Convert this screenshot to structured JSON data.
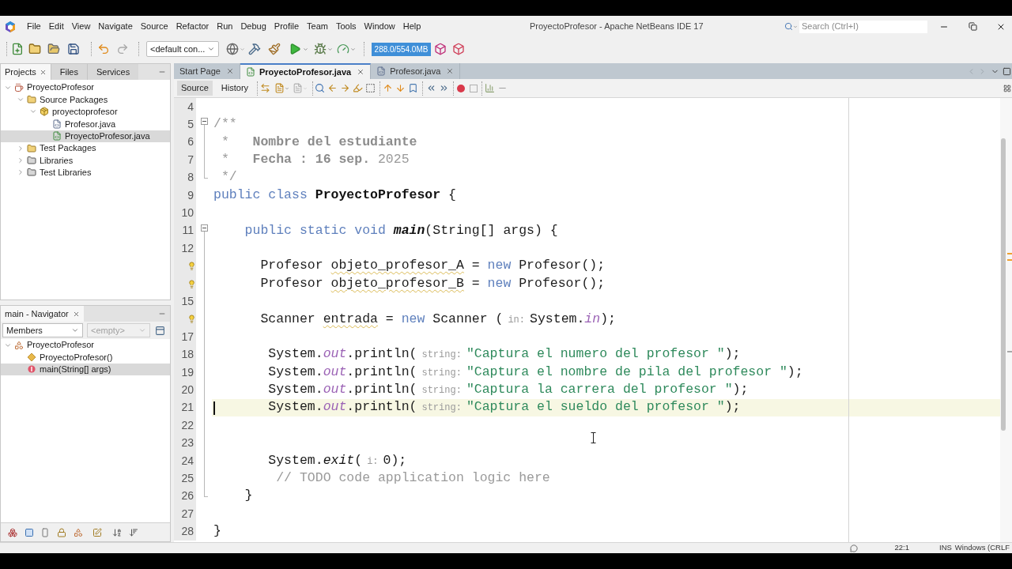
{
  "title_bar": {
    "menus": [
      "File",
      "Edit",
      "View",
      "Navigate",
      "Source",
      "Refactor",
      "Run",
      "Debug",
      "Profile",
      "Team",
      "Tools",
      "Window",
      "Help"
    ],
    "title": "ProyectoProfesor - Apache NetBeans IDE 17",
    "search": {
      "placeholder": "Search (Ctrl+I)"
    }
  },
  "toolbar": {
    "configuration": "<default con...",
    "memory": "288.0/554.0MB"
  },
  "projects_panel": {
    "tabs": [
      {
        "label": "Projects",
        "selected": true
      },
      {
        "label": "Files",
        "selected": false
      },
      {
        "label": "Services",
        "selected": false
      }
    ],
    "tree": [
      {
        "label": "ProyectoProfesor",
        "kind": "project",
        "expanded": true,
        "selected": false,
        "children": [
          {
            "label": "Source Packages",
            "kind": "source-root",
            "expanded": true,
            "selected": false,
            "children": [
              {
                "label": "proyectoprofesor",
                "kind": "package",
                "expanded": true,
                "selected": false,
                "children": [
                  {
                    "label": "Profesor.java",
                    "kind": "java-file",
                    "selected": false
                  },
                  {
                    "label": "ProyectoProfesor.java",
                    "kind": "main-java-file",
                    "selected": true
                  }
                ]
              }
            ]
          },
          {
            "label": "Test Packages",
            "kind": "source-root",
            "expanded": false,
            "selected": false
          },
          {
            "label": "Libraries",
            "kind": "library",
            "expanded": false,
            "selected": false
          },
          {
            "label": "Test Libraries",
            "kind": "library",
            "expanded": false,
            "selected": false
          }
        ]
      }
    ]
  },
  "navigator": {
    "title": "main - Navigator",
    "filter": {
      "value": "Members",
      "disabled": false
    },
    "scope": {
      "value": "<empty>",
      "disabled": true
    },
    "tree": [
      {
        "label": "ProyectoProfesor",
        "kind": "class",
        "expanded": true,
        "selected": false,
        "children": [
          {
            "label": "ProyectoProfesor()",
            "kind": "constructor",
            "selected": false
          },
          {
            "label": "main(String[] args)",
            "kind": "method",
            "selected": true
          }
        ]
      }
    ]
  },
  "editor": {
    "tabs": [
      {
        "label": "Start Page",
        "kind": "page",
        "selected": false
      },
      {
        "label": "ProyectoProfesor.java",
        "kind": "main-java-file",
        "selected": true
      },
      {
        "label": "Profesor.java",
        "kind": "java-file",
        "selected": false
      }
    ],
    "views": [
      {
        "label": "Source",
        "selected": true
      },
      {
        "label": "History",
        "selected": false
      }
    ],
    "lines": [
      {
        "number": "4",
        "kind": "plain",
        "warning": false,
        "current": false
      },
      {
        "number": "5",
        "kind": "fold-start",
        "warning": false,
        "current": false,
        "tokens": [
          {
            "kind": "comment",
            "text": "/**"
          }
        ]
      },
      {
        "number": "6",
        "kind": "fold-body",
        "warning": false,
        "current": false,
        "tokens": [
          {
            "kind": "comment",
            "text": " *   "
          },
          {
            "kind": "comment-bold",
            "text": "Nombre del estudiante"
          }
        ]
      },
      {
        "number": "7",
        "kind": "fold-body",
        "warning": false,
        "current": false,
        "tokens": [
          {
            "kind": "comment",
            "text": " *   "
          },
          {
            "kind": "comment-bold",
            "text": "Fecha : 16 sep."
          },
          {
            "kind": "comment",
            "text": " 2025"
          }
        ]
      },
      {
        "number": "8",
        "kind": "fold-end",
        "warning": false,
        "current": false,
        "tokens": [
          {
            "kind": "comment",
            "text": " */"
          }
        ]
      },
      {
        "number": "9",
        "kind": "plain",
        "warning": false,
        "current": false,
        "tokens": [
          {
            "kind": "keyword",
            "text": "public class "
          },
          {
            "kind": "class-name",
            "text": "ProyectoProfesor"
          },
          {
            "kind": "plain",
            "text": " {"
          }
        ]
      },
      {
        "number": "10",
        "kind": "plain",
        "warning": false,
        "current": false
      },
      {
        "number": "11",
        "kind": "fold-start",
        "warning": false,
        "current": false,
        "tokens": [
          {
            "kind": "keyword",
            "text": "    public static void "
          },
          {
            "kind": "method-decl",
            "text": "main"
          },
          {
            "kind": "plain",
            "text": "(String[] args) {"
          }
        ]
      },
      {
        "number": "12",
        "kind": "fold-body",
        "warning": false,
        "current": false
      },
      {
        "kind": "fold-body",
        "warning": true,
        "current": false,
        "tokens": [
          {
            "kind": "plain",
            "text": "      Profesor "
          },
          {
            "kind": "warning-var",
            "text": "objeto_profesor_A"
          },
          {
            "kind": "plain",
            "text": " = "
          },
          {
            "kind": "keyword",
            "text": "new"
          },
          {
            "kind": "plain",
            "text": " Profesor();"
          }
        ]
      },
      {
        "kind": "fold-body",
        "warning": true,
        "current": false,
        "tokens": [
          {
            "kind": "plain",
            "text": "      Profesor "
          },
          {
            "kind": "warning-var",
            "text": "objeto_profesor_B"
          },
          {
            "kind": "plain",
            "text": " = "
          },
          {
            "kind": "keyword",
            "text": "new"
          },
          {
            "kind": "plain",
            "text": " Profesor();"
          }
        ]
      },
      {
        "number": "15",
        "kind": "fold-body",
        "warning": false,
        "current": false
      },
      {
        "kind": "fold-body",
        "warning": true,
        "current": false,
        "tokens": [
          {
            "kind": "plain",
            "text": "      Scanner "
          },
          {
            "kind": "warning-var",
            "text": "entrada"
          },
          {
            "kind": "plain",
            "text": " = "
          },
          {
            "kind": "keyword",
            "text": "new"
          },
          {
            "kind": "plain",
            "text": " Scanner ("
          },
          {
            "kind": "hint",
            "text": "in:"
          },
          {
            "kind": "plain",
            "text": "System."
          },
          {
            "kind": "static-field",
            "text": "in"
          },
          {
            "kind": "plain",
            "text": ");"
          }
        ]
      },
      {
        "number": "17",
        "kind": "fold-body",
        "warning": false,
        "current": false
      },
      {
        "number": "18",
        "kind": "fold-body",
        "warning": false,
        "current": false,
        "tokens": [
          {
            "kind": "plain",
            "text": "       System."
          },
          {
            "kind": "static-field",
            "text": "out"
          },
          {
            "kind": "plain",
            "text": ".println("
          },
          {
            "kind": "hint",
            "text": "string:"
          },
          {
            "kind": "string",
            "text": "\"Captura el numero del profesor \""
          },
          {
            "kind": "plain",
            "text": ");"
          }
        ]
      },
      {
        "number": "19",
        "kind": "fold-body",
        "warning": false,
        "current": false,
        "tokens": [
          {
            "kind": "plain",
            "text": "       System."
          },
          {
            "kind": "static-field",
            "text": "out"
          },
          {
            "kind": "plain",
            "text": ".println("
          },
          {
            "kind": "hint",
            "text": "string:"
          },
          {
            "kind": "string",
            "text": "\"Captura el nombre de pila del profesor \""
          },
          {
            "kind": "plain",
            "text": ");"
          }
        ]
      },
      {
        "number": "20",
        "kind": "fold-body",
        "warning": false,
        "current": false,
        "tokens": [
          {
            "kind": "plain",
            "text": "       System."
          },
          {
            "kind": "static-field",
            "text": "out"
          },
          {
            "kind": "plain",
            "text": ".println("
          },
          {
            "kind": "hint",
            "text": "string:"
          },
          {
            "kind": "string",
            "text": "\"Captura la carrera del profesor \""
          },
          {
            "kind": "plain",
            "text": ");"
          }
        ]
      },
      {
        "number": "21",
        "kind": "fold-body",
        "warning": false,
        "current": true,
        "tokens": [
          {
            "kind": "plain",
            "text": "       System."
          },
          {
            "kind": "static-field",
            "text": "out"
          },
          {
            "kind": "plain",
            "text": ".println("
          },
          {
            "kind": "hint",
            "text": "string:"
          },
          {
            "kind": "string",
            "text": "\"Captura el sueldo del profesor \""
          },
          {
            "kind": "plain",
            "text": ");"
          }
        ]
      },
      {
        "number": "22",
        "kind": "fold-body",
        "warning": false,
        "current": false
      },
      {
        "number": "23",
        "kind": "fold-body",
        "warning": false,
        "current": false
      },
      {
        "number": "24",
        "kind": "fold-body",
        "warning": false,
        "current": false,
        "tokens": [
          {
            "kind": "plain",
            "text": "       System."
          },
          {
            "kind": "static-method",
            "text": "exit"
          },
          {
            "kind": "plain",
            "text": "("
          },
          {
            "kind": "hint",
            "text": "i:"
          },
          {
            "kind": "plain",
            "text": "0);"
          }
        ]
      },
      {
        "number": "25",
        "kind": "fold-body",
        "warning": false,
        "current": false,
        "tokens": [
          {
            "kind": "comment",
            "text": "        // TODO code application logic here"
          }
        ]
      },
      {
        "number": "26",
        "kind": "fold-end",
        "warning": false,
        "current": false,
        "tokens": [
          {
            "kind": "plain",
            "text": "    }"
          }
        ]
      },
      {
        "number": "27",
        "kind": "plain",
        "warning": false,
        "current": false
      },
      {
        "number": "28",
        "kind": "plain",
        "warning": false,
        "current": false,
        "tokens": [
          {
            "kind": "plain",
            "text": "}"
          }
        ]
      }
    ]
  },
  "status_bar": {
    "position": "22:1",
    "insert_mode": "INS",
    "line_endings": "Windows (CRLF"
  }
}
